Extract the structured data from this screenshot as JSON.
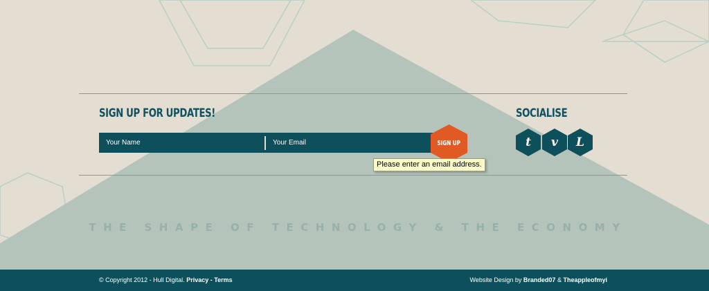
{
  "signup": {
    "heading": "Sign up for updates!",
    "name_placeholder": "Your Name",
    "email_placeholder": "Your Email",
    "button_label": "Sign up",
    "validation_tooltip": "Please enter an email address."
  },
  "socialise": {
    "heading": "Socialise",
    "icons": [
      {
        "name": "twitter-icon",
        "glyph": "t"
      },
      {
        "name": "vimeo-icon",
        "glyph": "v"
      },
      {
        "name": "lanyrd-icon",
        "glyph": "L"
      }
    ]
  },
  "tagline": "The Shape of Technology & the Economy",
  "footer": {
    "copyright": "© Copyright 2012 - Hull Digital.",
    "privacy_link": "Privacy",
    "separator": "-",
    "terms_link": "Terms",
    "design_prefix": "Website Design by",
    "designer_1": "Branded07",
    "ampersand": "&",
    "designer_2": "Theappleofmyi"
  },
  "colors": {
    "background": "#e3ddd2",
    "triangle": "#b5c4bb",
    "teal": "#0e4f5c",
    "accent_orange": "#e15a24",
    "tooltip_bg": "#fbfbc9"
  }
}
